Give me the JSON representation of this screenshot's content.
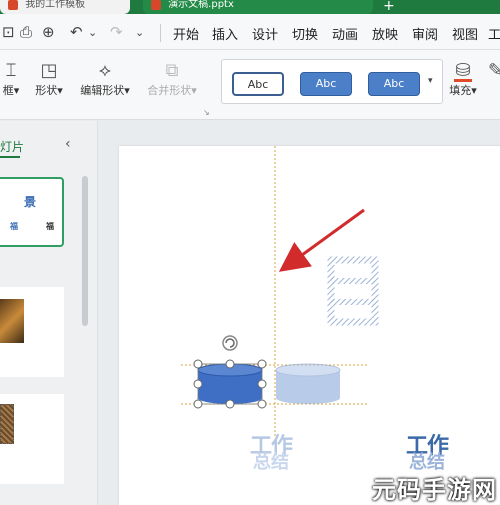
{
  "titlebar": {
    "tab1_label": "我的工作模板",
    "tab2_label": "演示文稿.pptx",
    "plus": "+"
  },
  "quick_access": {
    "save": "⊡",
    "print": "⎙",
    "preview": "⊕",
    "undo": "↶",
    "redo": "↷",
    "more": "⌄"
  },
  "menu": {
    "items": [
      "开始",
      "插入",
      "设计",
      "切换",
      "动画",
      "放映",
      "审阅",
      "视图",
      "工"
    ]
  },
  "ribbon": {
    "outline_label": "框",
    "shape_label": "形状",
    "edit_shape_label": "编辑形状",
    "merge_shape_label": "合并形状",
    "fill_label": "填充",
    "abc_styles": [
      "Abc",
      "Abc",
      "Abc"
    ]
  },
  "left_panel": {
    "title": "灯片",
    "collapse": "‹",
    "thumb1_text_top": "景",
    "thumb1_text_left": "福",
    "thumb1_text_right": "福"
  },
  "slide": {
    "text_left_top": "工作",
    "text_left_bottom": "总结",
    "text_right_top": "工作",
    "text_right_bottom": "总结",
    "selected_shape": "cylinder",
    "arrow_color": "#d22b2b"
  },
  "watermark": "元码手游网"
}
